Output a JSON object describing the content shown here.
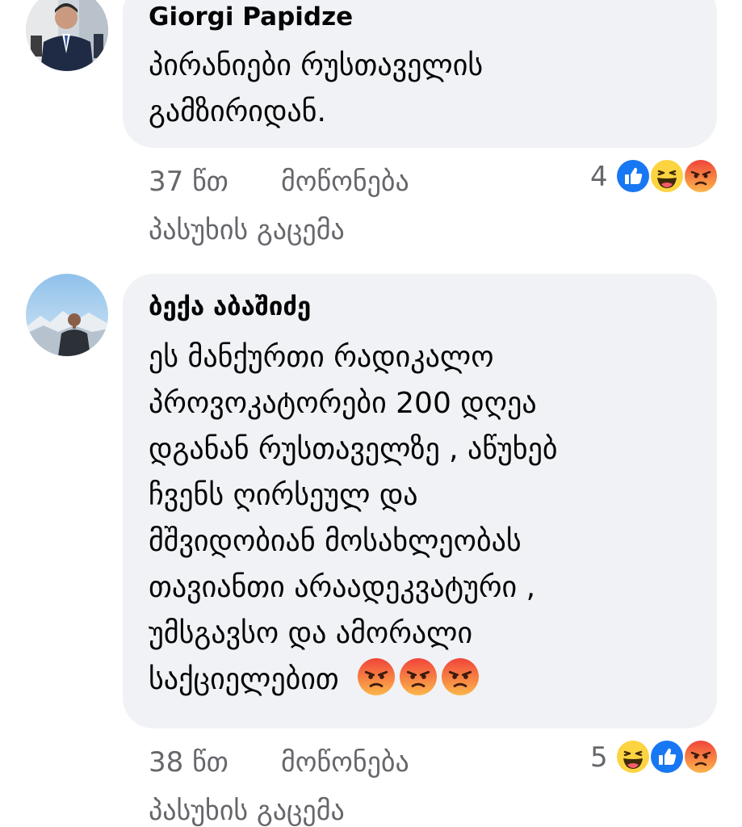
{
  "comments": [
    {
      "author": "Giorgi Papidze",
      "text_lines": [
        "პირანიები რუსთაველის",
        "გამზირიდან."
      ],
      "time": "37 წთ",
      "like_label": "მოწონება",
      "reply_label": "პასუხის გაცემა",
      "reaction_count": "4",
      "reactions": [
        "like-icon",
        "haha-icon",
        "angry-icon"
      ]
    },
    {
      "author": "ბექა აბაშიძე",
      "text_lines": [
        "ეს მანქურთი რადიკალო",
        "პროვოკატორები 200 დღეა",
        "დგანან რუსთაველზე , აწუხებ",
        "ჩვენს ღირსეულ და",
        "მშვიდობიან მოსახლეობას",
        "თავიანთი არაადეკვატური ,",
        "უმსგავსო და ამორალი",
        "საქციელებით"
      ],
      "inline_emojis": [
        "angry-emoji",
        "angry-emoji",
        "angry-emoji"
      ],
      "time": "38 წთ",
      "like_label": "მოწონება",
      "reply_label": "პასუხის გაცემა",
      "reaction_count": "5",
      "reactions": [
        "haha-icon",
        "like-icon",
        "angry-icon"
      ]
    }
  ],
  "colors": {
    "bubble": "#f0f2f5",
    "meta_text": "#65676b",
    "like_blue": "#1877f2",
    "haha_yellow": "#fcd441",
    "angry_red": "#e9710f"
  }
}
